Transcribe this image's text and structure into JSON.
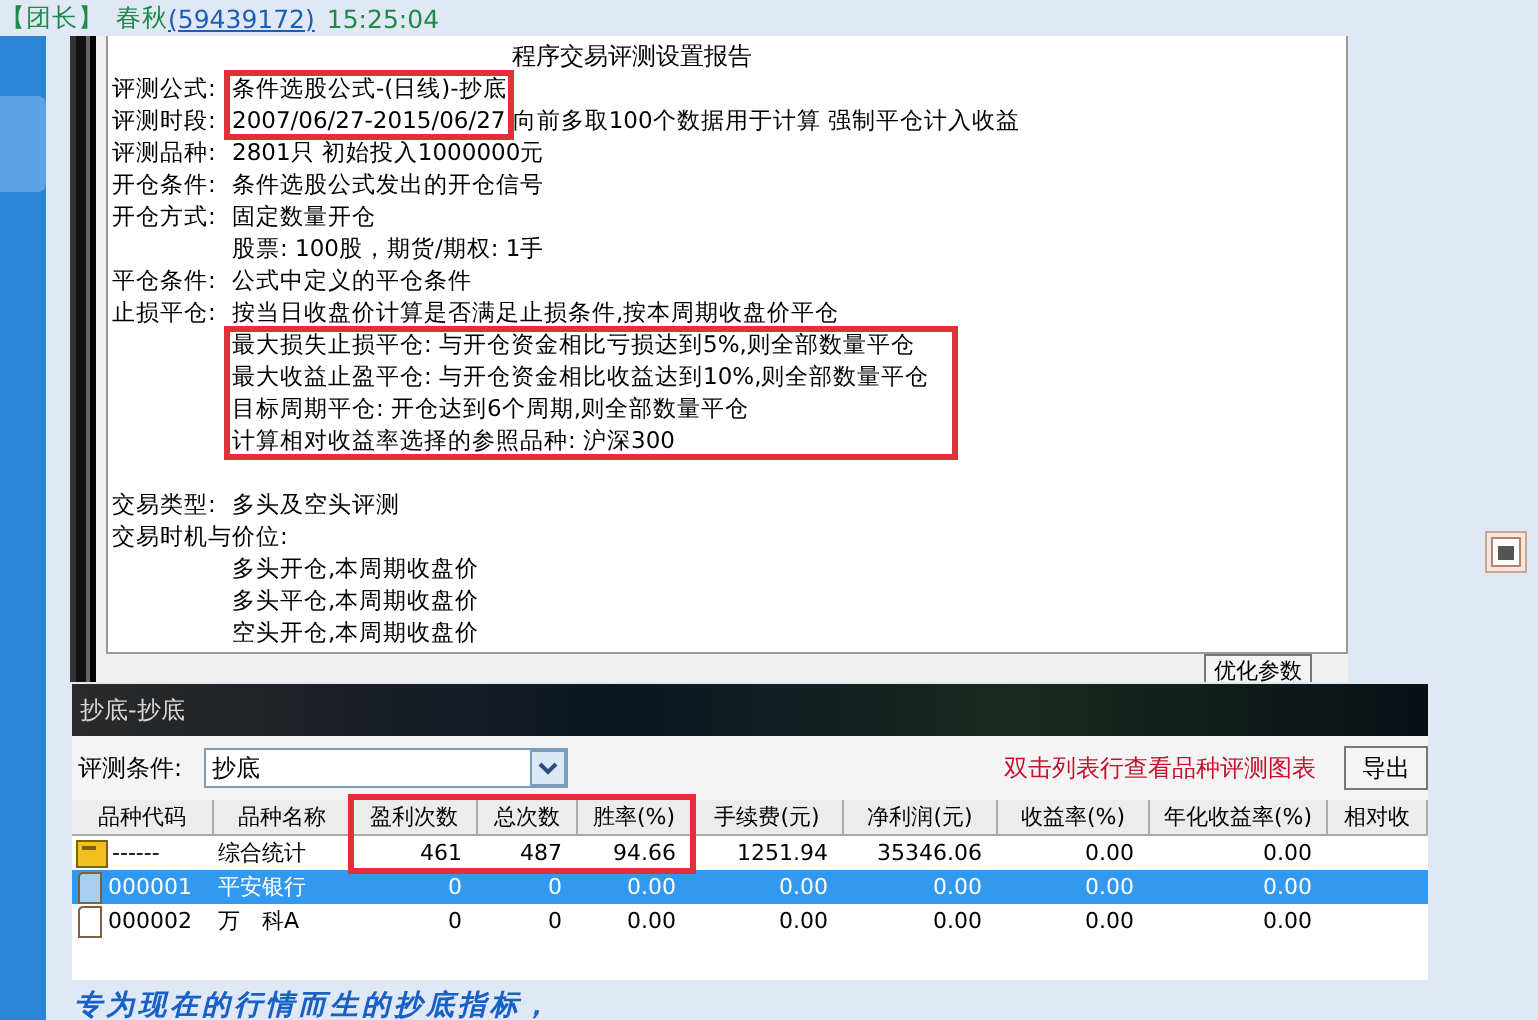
{
  "message_header": {
    "role": "【团长】",
    "name": "春秋",
    "qq": "(59439172)",
    "time": "15:25:04"
  },
  "report": {
    "title": "程序交易评测设置报告",
    "groups": [
      {
        "highlighted": true,
        "lines": [
          {
            "label": "评测公式:",
            "value": "条件选股公式-(日线)-抄底"
          },
          {
            "label": "评测时段:",
            "value": "2007/06/27-2015/06/27 向前多取100个数据用于计算 强制平仓计入收益"
          }
        ]
      },
      {
        "highlighted": false,
        "lines": [
          {
            "label": "评测品种:",
            "value": "2801只 初始投入1000000元"
          },
          {
            "label": "开仓条件:",
            "value": "条件选股公式发出的开仓信号"
          },
          {
            "label": "开仓方式:",
            "value": "固定数量开仓"
          },
          {
            "value": "股票: 100股，期货/期权: 1手"
          },
          {
            "label": "平仓条件:",
            "value": "公式中定义的平仓条件"
          },
          {
            "label": "止损平仓:",
            "value": "按当日收盘价计算是否满足止损条件,按本周期收盘价平仓"
          }
        ]
      },
      {
        "highlighted": true,
        "lines": [
          {
            "value": "最大损失止损平仓: 与开仓资金相比亏损达到5%,则全部数量平仓"
          },
          {
            "value": "最大收益止盈平仓: 与开仓资金相比收益达到10%,则全部数量平仓"
          },
          {
            "value": "目标周期平仓: 开仓达到6个周期,则全部数量平仓"
          },
          {
            "value": "计算相对收益率选择的参照品种: 沪深300"
          }
        ]
      },
      {
        "highlighted": false,
        "lines": [
          {
            "label": "交易类型:",
            "value": "多头及空头评测"
          },
          {
            "label": "交易时机与价位:"
          },
          {
            "value": "多头开仓,本周期收盘价"
          },
          {
            "value": "多头平仓,本周期收盘价"
          },
          {
            "value": "空头开仓,本周期收盘价"
          }
        ]
      }
    ]
  },
  "optimize_button": "优化参数",
  "result_panel": {
    "title": "抄底-抄底",
    "filter_label": "评测条件:",
    "filter_value": "抄底",
    "hint": "双击列表行查看品种评测图表",
    "export_button": "导出",
    "columns": [
      {
        "label": "品种代码",
        "highlighted": false
      },
      {
        "label": "品种名称",
        "highlighted": false
      },
      {
        "label": "盈利次数",
        "highlighted": true
      },
      {
        "label": "总次数",
        "highlighted": true
      },
      {
        "label": "胜率(%)",
        "highlighted": true
      },
      {
        "label": "手续费(元)",
        "highlighted": false
      },
      {
        "label": "净利润(元)",
        "highlighted": false
      },
      {
        "label": "收益率(%)",
        "highlighted": false
      },
      {
        "label": "年化收益率(%)",
        "highlighted": false
      },
      {
        "label": "相对收",
        "highlighted": false
      }
    ],
    "rows": [
      {
        "kind": "summary",
        "selected": false,
        "cells": [
          "------",
          "综合统计",
          "461",
          "487",
          "94.66",
          "1251.94",
          "35346.06",
          "0.00",
          "0.00"
        ]
      },
      {
        "kind": "stock",
        "selected": true,
        "cells": [
          "000001",
          "平安银行",
          "0",
          "0",
          "0.00",
          "0.00",
          "0.00",
          "0.00",
          "0.00"
        ]
      },
      {
        "kind": "stock",
        "selected": false,
        "cells": [
          "000002",
          "万　科A",
          "0",
          "0",
          "0.00",
          "0.00",
          "0.00",
          "0.00",
          "0.00"
        ]
      }
    ]
  },
  "caption": "专为现在的行情而生的抄底指标，"
}
